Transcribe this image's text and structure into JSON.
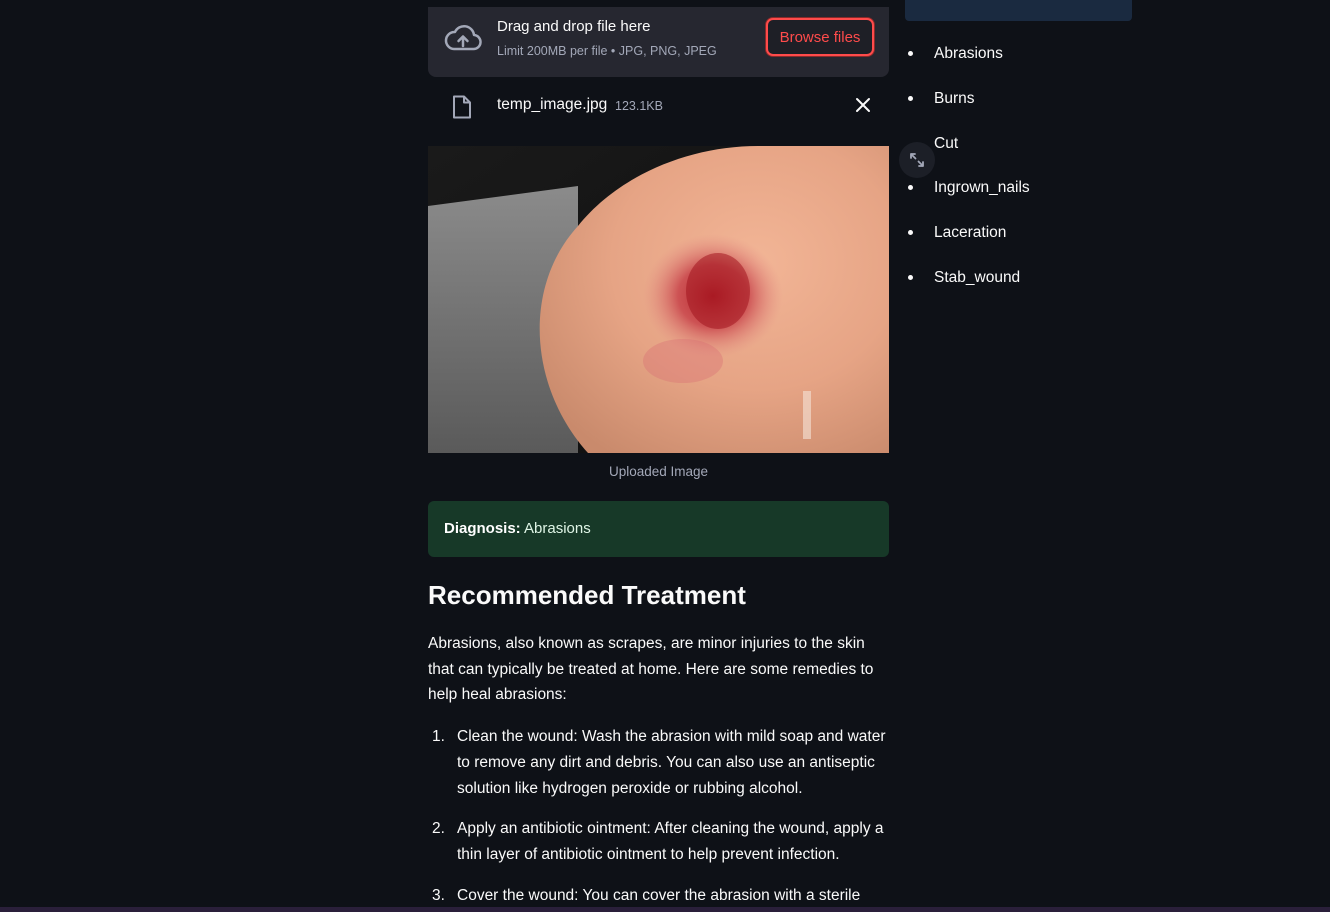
{
  "uploader": {
    "title": "Drag and drop file here",
    "limit": "Limit 200MB per file • JPG, PNG, JPEG",
    "browse_label": "Browse files",
    "file_name": "temp_image.jpg",
    "file_size": "123.1KB"
  },
  "image": {
    "caption": "Uploaded Image"
  },
  "diagnosis": {
    "label": "Diagnosis:",
    "value": "Abrasions"
  },
  "treatment": {
    "title": "Recommended Treatment",
    "intro": "Abrasions, also known as scrapes, are minor injuries to the skin that can typically be treated at home. Here are some remedies to help heal abrasions:",
    "steps": [
      {
        "num": "1.",
        "text": "Clean the wound: Wash the abrasion with mild soap and water to remove any dirt and debris. You can also use an antiseptic solution like hydrogen peroxide or rubbing alcohol."
      },
      {
        "num": "2.",
        "text": "Apply an antibiotic ointment: After cleaning the wound, apply a thin layer of antibiotic ointment to help prevent infection."
      },
      {
        "num": "3.",
        "text": "Cover the wound: You can cover the abrasion with a sterile"
      }
    ]
  },
  "classes": [
    "Abrasions",
    "Burns",
    "Cut",
    "Ingrown_nails",
    "Laceration",
    "Stab_wound"
  ],
  "colors": {
    "background": "#0e1117",
    "accent": "#ff4b4b",
    "success_bg": "#173928"
  }
}
